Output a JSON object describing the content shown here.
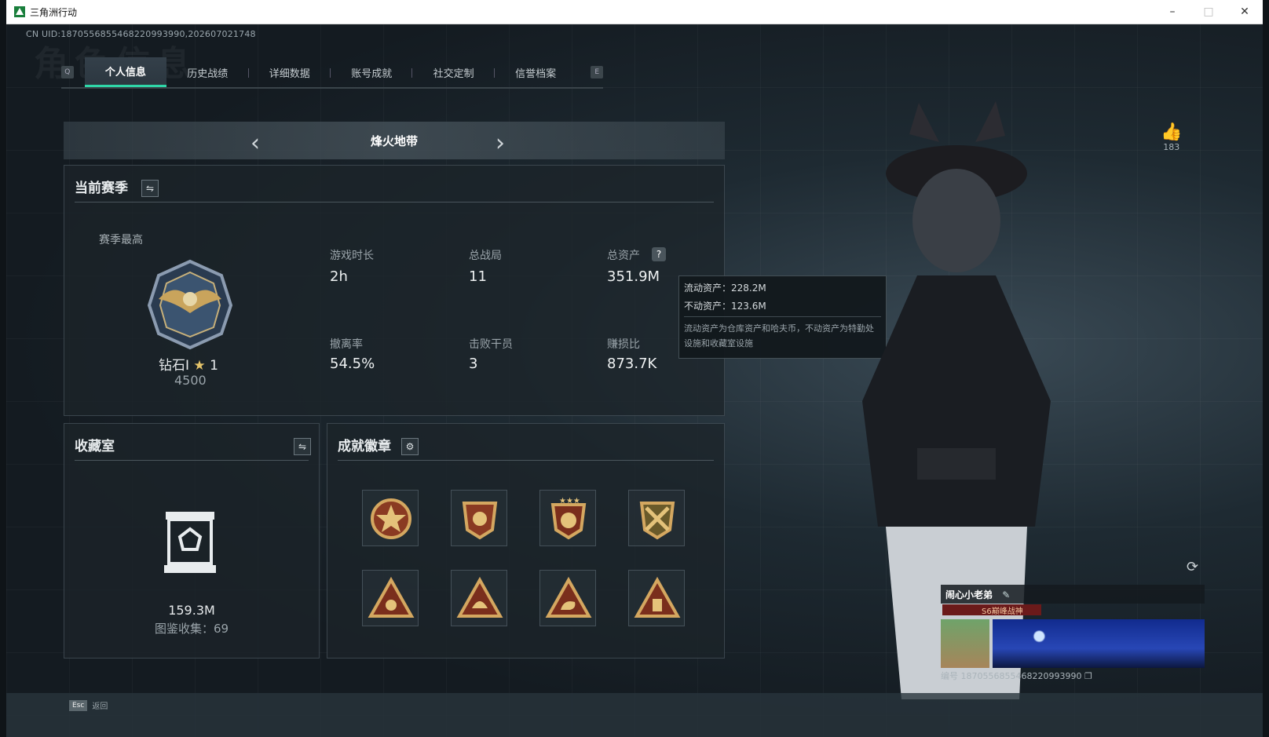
{
  "window": {
    "title": "三角洲行动",
    "controls": [
      "–",
      "□",
      "✕"
    ]
  },
  "uid_text": "CN UID:1870556855468220993990,202607021748",
  "background_title": "角色信息",
  "tabs": {
    "left_key": "Q",
    "right_key": "E",
    "items": [
      "个人信息",
      "历史战绩",
      "详细数据",
      "账号成就",
      "社交定制",
      "信誉档案"
    ],
    "active": "个人信息"
  },
  "mode": {
    "title": "烽火地带",
    "prev": "‹",
    "next": "›"
  },
  "season": {
    "title": "当前赛季",
    "best_label": "赛季最高",
    "rank": "钻石I",
    "stars": "1",
    "score": "4500",
    "stats": [
      {
        "label": "游戏时长",
        "value": "2h"
      },
      {
        "label": "总战局",
        "value": "11"
      },
      {
        "label": "总资产",
        "value": "351.9M"
      },
      {
        "label": "撤离率",
        "value": "54.5%"
      },
      {
        "label": "击败干员",
        "value": "3"
      },
      {
        "label": "赚损比",
        "value": "873.7K"
      }
    ]
  },
  "tooltip": {
    "liquid": "流动资产：228.2M",
    "fixed": "不动资产：123.6M",
    "note": "流动资产为仓库资产和哈夫币，不动资产为特勤处设施和收藏室设施"
  },
  "collection": {
    "title": "收藏室",
    "value": "159.3M",
    "count_label": "图鉴收集：69"
  },
  "badges": {
    "title": "成就徽章",
    "icons": [
      "star-badge-icon",
      "shield-fist-badge-icon",
      "shield-stars-badge-icon",
      "crossed-rifles-badge-icon",
      "horn-triangle-badge-icon",
      "helmet-triangle-badge-icon",
      "arm-triangle-badge-icon",
      "backpack-triangle-badge-icon"
    ]
  },
  "likes": {
    "count": "183"
  },
  "profile": {
    "name": "闹心小老弟",
    "rank_tag": "S6巅峰战神",
    "id_text": "编号 1870556855468220993990"
  },
  "footer": {
    "key": "Esc",
    "label": "返回"
  },
  "colors": {
    "accent": "#2fd6a8",
    "tooltip_bg": "#12181c",
    "rank_strip": "#6b1a1a"
  }
}
